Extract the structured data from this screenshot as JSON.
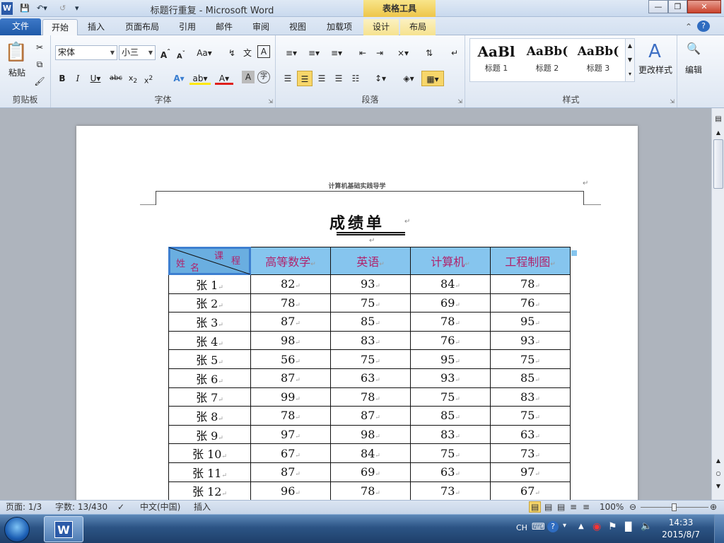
{
  "window": {
    "title": "标题行重复 - Microsoft Word",
    "contextual_tab_group": "表格工具"
  },
  "tabs": [
    "文件",
    "开始",
    "插入",
    "页面布局",
    "引用",
    "邮件",
    "审阅",
    "视图",
    "加载项",
    "设计",
    "布局"
  ],
  "ribbon": {
    "clipboard": {
      "paste": "粘贴",
      "label": "剪贴板"
    },
    "font": {
      "name": "宋体",
      "size": "小三",
      "label": "字体"
    },
    "paragraph": {
      "label": "段落"
    },
    "styles": {
      "items": [
        {
          "preview": "AaBl",
          "name": "标题 1"
        },
        {
          "preview": "AaBb(",
          "name": "标题 2"
        },
        {
          "preview": "AaBb(",
          "name": "标题 3"
        }
      ],
      "change": "更改样式",
      "label": "样式"
    },
    "editing": {
      "label": "编辑"
    }
  },
  "document": {
    "header_text": "计算机基础实践导学",
    "title": "成绩单",
    "table": {
      "corner": {
        "top": "课",
        "top2": "程",
        "bottom": "姓",
        "bottom2": "名"
      },
      "headers": [
        "高等数学",
        "英语",
        "计算机",
        "工程制图"
      ],
      "rows": [
        {
          "name": "张 1",
          "values": [
            "82",
            "93",
            "84",
            "78"
          ]
        },
        {
          "name": "张 2",
          "values": [
            "78",
            "75",
            "69",
            "76"
          ]
        },
        {
          "name": "张 3",
          "values": [
            "87",
            "85",
            "78",
            "95"
          ]
        },
        {
          "name": "张 4",
          "values": [
            "98",
            "83",
            "76",
            "93"
          ]
        },
        {
          "name": "张 5",
          "values": [
            "56",
            "75",
            "95",
            "75"
          ]
        },
        {
          "name": "张 6",
          "values": [
            "87",
            "63",
            "93",
            "85"
          ]
        },
        {
          "name": "张 7",
          "values": [
            "99",
            "78",
            "75",
            "83"
          ]
        },
        {
          "name": "张 8",
          "values": [
            "78",
            "87",
            "85",
            "75"
          ]
        },
        {
          "name": "张 9",
          "values": [
            "97",
            "98",
            "83",
            "63"
          ]
        },
        {
          "name": "张 10",
          "values": [
            "67",
            "84",
            "75",
            "73"
          ]
        },
        {
          "name": "张 11",
          "values": [
            "87",
            "69",
            "63",
            "97"
          ]
        },
        {
          "name": "张 12",
          "values": [
            "96",
            "78",
            "73",
            "67"
          ]
        }
      ]
    }
  },
  "statusbar": {
    "page": "页面: 1/3",
    "words": "字数: 13/430",
    "language": "中文(中国)",
    "mode": "插入",
    "zoom": "100%"
  },
  "taskbar": {
    "ime": "CH",
    "time": "14:33",
    "date": "2015/8/7"
  }
}
